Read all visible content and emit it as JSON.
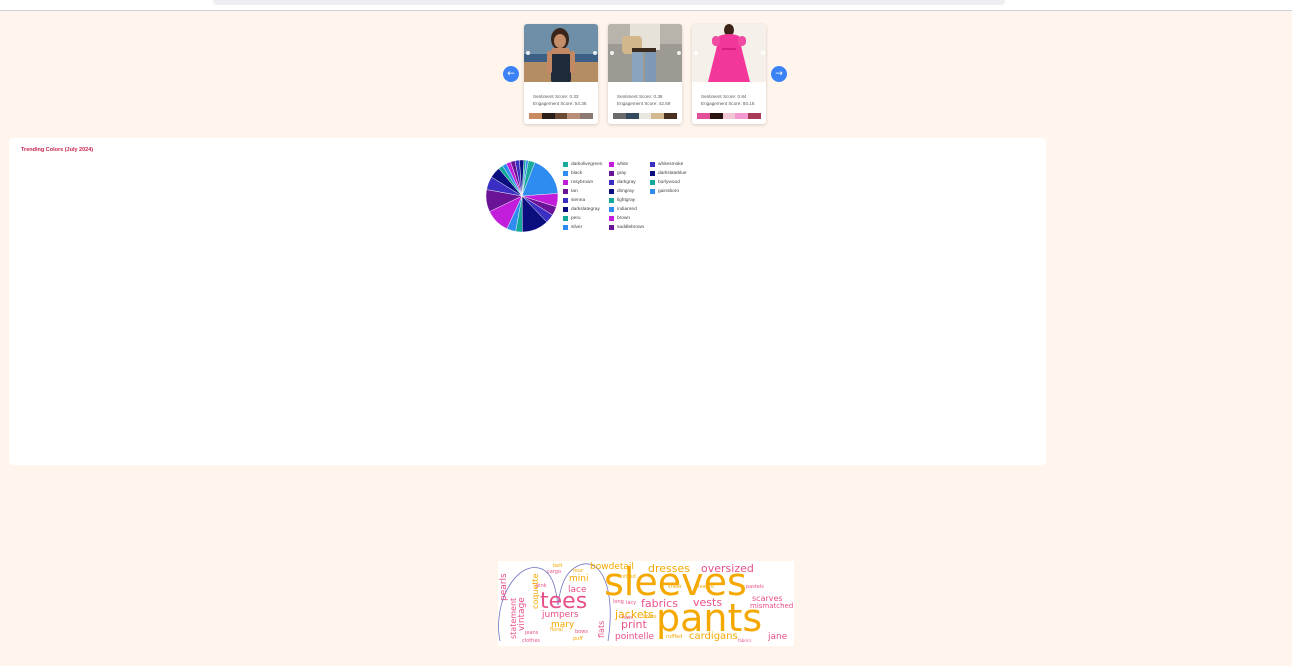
{
  "carousel": {
    "prev_label": "←",
    "next_label": "→",
    "cards": [
      {
        "sentiment": "Sentiment Score: 0.33",
        "engagement": "Engagement Score: 54.36",
        "swatches": [
          "#c98a60",
          "#2b1e18",
          "#6a4a35",
          "#b98f7a",
          "#8b7a72"
        ]
      },
      {
        "sentiment": "Sentiment Score: 0.36",
        "engagement": "Engagement Score: 42.59",
        "swatches": [
          "#6b6b6b",
          "#34495e",
          "#e9e6df",
          "#d4b890",
          "#4a3020"
        ]
      },
      {
        "sentiment": "Sentiment Score: 0.84",
        "engagement": "Engagement Score: 93.16",
        "swatches": [
          "#e2509a",
          "#2a1410",
          "#f1c7d6",
          "#f29ad0",
          "#a83a58"
        ]
      }
    ]
  },
  "trending_panel": {
    "title": "Trending Colors (July 2024)"
  },
  "chart_data": {
    "type": "pie",
    "title": "",
    "labels": [
      "darkolivegreen",
      "black",
      "rosybrown",
      "tan",
      "sienna",
      "darkslategray",
      "peru",
      "silver",
      "white",
      "gray",
      "darkgray",
      "dimgray",
      "lightgray",
      "indianred",
      "brown",
      "saddlebrown",
      "whitesmoke",
      "darkslateblue",
      "burlywood",
      "gainsboro"
    ],
    "values": [
      3,
      18,
      6,
      4,
      4,
      12,
      3,
      4,
      11,
      10,
      6,
      5,
      2,
      2,
      2,
      2,
      2,
      2,
      1,
      1
    ],
    "colors": [
      "#1aab9b",
      "#2e8bf0",
      "#c11ddb",
      "#6a1397",
      "#3a2fc2",
      "#0b0e7f",
      "#14a89a",
      "#2e8bf0",
      "#c11ddb",
      "#6a1397",
      "#3a2fc2",
      "#0b0e7f",
      "#14a89a",
      "#2e8bf0",
      "#c11ddb",
      "#6a1397",
      "#3a2fc2",
      "#0b0e7f",
      "#14a89a",
      "#2e8bf0"
    ],
    "legend_position": "right",
    "legend_columns": 3
  },
  "wordcloud": {
    "words": [
      {
        "text": "sleeves",
        "color": "#f5a800",
        "size": 38,
        "rotate": 0
      },
      {
        "text": "pants",
        "color": "#f5a800",
        "size": 38,
        "rotate": 0
      },
      {
        "text": "tees",
        "color": "#e8508a",
        "size": 22,
        "rotate": 0
      },
      {
        "text": "dresses",
        "color": "#f5a800",
        "size": 11,
        "rotate": 0
      },
      {
        "text": "oversized",
        "color": "#e8508a",
        "size": 11,
        "rotate": 0
      },
      {
        "text": "bowdetail",
        "color": "#f5a800",
        "size": 9,
        "rotate": 0
      },
      {
        "text": "fabrics",
        "color": "#e8508a",
        "size": 11,
        "rotate": 0
      },
      {
        "text": "vests",
        "color": "#e8508a",
        "size": 11,
        "rotate": 0
      },
      {
        "text": "jackets",
        "color": "#f5a800",
        "size": 11,
        "rotate": 0
      },
      {
        "text": "print",
        "color": "#e8508a",
        "size": 11,
        "rotate": 0
      },
      {
        "text": "cardigans",
        "color": "#f5a800",
        "size": 10,
        "rotate": 0
      },
      {
        "text": "pointelle",
        "color": "#e8508a",
        "size": 9,
        "rotate": 0
      },
      {
        "text": "jane",
        "color": "#e8508a",
        "size": 9,
        "rotate": 0
      },
      {
        "text": "mini",
        "color": "#f5a800",
        "size": 9,
        "rotate": 0
      },
      {
        "text": "lace",
        "color": "#e8508a",
        "size": 9,
        "rotate": 0
      },
      {
        "text": "jumpers",
        "color": "#e8508a",
        "size": 9,
        "rotate": 0
      },
      {
        "text": "mary",
        "color": "#f5a800",
        "size": 9,
        "rotate": 0
      },
      {
        "text": "scarves",
        "color": "#e8508a",
        "size": 8,
        "rotate": 0
      },
      {
        "text": "mismatched",
        "color": "#e8508a",
        "size": 7,
        "rotate": 0
      },
      {
        "text": "vintage",
        "color": "#e8508a",
        "size": 9,
        "rotate": -90
      },
      {
        "text": "pearls",
        "color": "#e8508a",
        "size": 9,
        "rotate": -90
      },
      {
        "text": "statement",
        "color": "#e8508a",
        "size": 8,
        "rotate": -90
      },
      {
        "text": "coquette",
        "color": "#f5a800",
        "size": 8,
        "rotate": -90
      },
      {
        "text": "flats",
        "color": "#e8508a",
        "size": 8,
        "rotate": -90
      },
      {
        "text": "belt",
        "color": "#f5a800",
        "size": 5,
        "rotate": 0
      },
      {
        "text": "cargo",
        "color": "#e8508a",
        "size": 5,
        "rotate": 0
      },
      {
        "text": "pink",
        "color": "#e8508a",
        "size": 5,
        "rotate": 0
      },
      {
        "text": "four",
        "color": "#f5a800",
        "size": 5,
        "rotate": 0
      },
      {
        "text": "knitted",
        "color": "#f5a800",
        "size": 5,
        "rotate": 0
      },
      {
        "text": "sheer",
        "color": "#f5a800",
        "size": 5,
        "rotate": 0
      },
      {
        "text": "pleated",
        "color": "#f5a800",
        "size": 5,
        "rotate": 0
      },
      {
        "text": "pastels",
        "color": "#e8508a",
        "size": 5,
        "rotate": 0
      },
      {
        "text": "coats",
        "color": "#f5a800",
        "size": 5,
        "rotate": 0
      },
      {
        "text": "hats",
        "color": "#e8508a",
        "size": 5,
        "rotate": 0
      },
      {
        "text": "long",
        "color": "#e8508a",
        "size": 5,
        "rotate": 0
      },
      {
        "text": "lacy",
        "color": "#e8508a",
        "size": 5,
        "rotate": 0
      },
      {
        "text": "ruffled",
        "color": "#f5a800",
        "size": 5,
        "rotate": 0
      },
      {
        "text": "floral",
        "color": "#f5a800",
        "size": 5,
        "rotate": 0
      },
      {
        "text": "bows",
        "color": "#e8508a",
        "size": 5,
        "rotate": 0
      },
      {
        "text": "jeans",
        "color": "#e8508a",
        "size": 5,
        "rotate": 0
      },
      {
        "text": "clothes",
        "color": "#e8508a",
        "size": 5,
        "rotate": 0
      },
      {
        "text": "puff",
        "color": "#f5a800",
        "size": 5,
        "rotate": 0
      },
      {
        "text": "fabrics",
        "color": "#e8508a",
        "size": 4,
        "rotate": 0
      }
    ]
  }
}
